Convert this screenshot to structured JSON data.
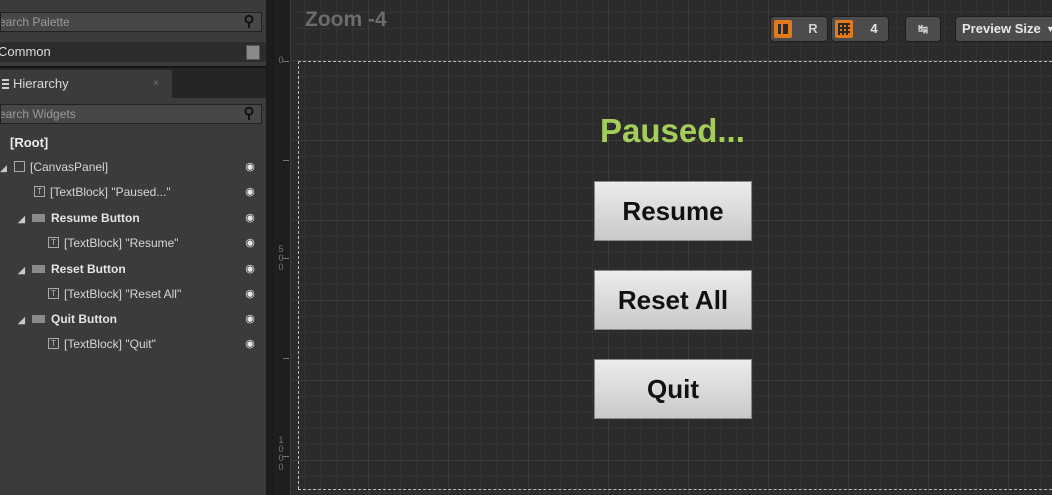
{
  "palette": {
    "search_placeholder": "earch Palette",
    "category": "Common"
  },
  "hierarchy": {
    "tab_label": "Hierarchy",
    "tab_close": "×",
    "search_placeholder": "earch Widgets",
    "root": "[Root]",
    "nodes": [
      {
        "label": "[CanvasPanel]"
      },
      {
        "label": "[TextBlock] \"Paused...\""
      },
      {
        "label": "Resume Button"
      },
      {
        "label": "[TextBlock] \"Resume\""
      },
      {
        "label": "Reset Button"
      },
      {
        "label": "[TextBlock] \"Reset All\""
      },
      {
        "label": "Quit Button"
      },
      {
        "label": "[TextBlock] \"Quit\""
      }
    ]
  },
  "designer": {
    "zoom": "Zoom -4",
    "toolbar": {
      "r_label": "R",
      "grid_value": "4",
      "preview_size": "Preview Size"
    },
    "ruler_labels": [
      "0",
      "5",
      "0",
      "0",
      "1",
      "0",
      "0",
      "0"
    ]
  },
  "menu": {
    "title": "Paused...",
    "buttons": [
      "Resume",
      "Reset All",
      "Quit"
    ]
  },
  "colors": {
    "title_green": "#a4cd5a",
    "toolbar_orange": "#e07a1c"
  }
}
